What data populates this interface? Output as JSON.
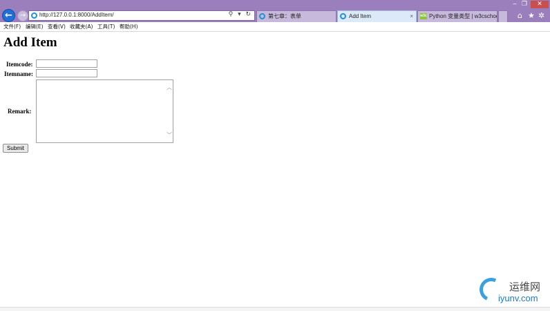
{
  "browser": {
    "url": "http://127.0.0.1:8000/AddItem/",
    "address_icons": "⚲ ▾ ↻",
    "back_glyph": "←",
    "forward_glyph": "→",
    "tabs": [
      {
        "label": "第七章：表单",
        "active": false
      },
      {
        "label": "Add Item",
        "active": true
      },
      {
        "label": "Python 变量类型 | w3cschool...",
        "active": false
      }
    ],
    "tab_close_glyph": "×",
    "window_controls": {
      "minimize": "‒",
      "restore": "❐",
      "close": "✕"
    },
    "toolbar_icons": {
      "home": "⌂",
      "favorites": "★",
      "settings": "✲"
    },
    "w3_icon_text": "w3c",
    "accent_color": "#9b7fbc"
  },
  "menubar": {
    "items": [
      "文件(F)",
      "编辑(E)",
      "查看(V)",
      "收藏夹(A)",
      "工具(T)",
      "帮助(H)"
    ]
  },
  "page": {
    "title": "Add Item",
    "fields": {
      "itemcode_label": "Itemcode:",
      "itemcode_value": "",
      "itemname_label": "Itemname:",
      "itemname_value": "",
      "remark_label": "Remark:",
      "remark_value": ""
    },
    "submit_label": "Submit"
  },
  "watermark": {
    "cn": "运维网",
    "en": "iyunv.com"
  }
}
